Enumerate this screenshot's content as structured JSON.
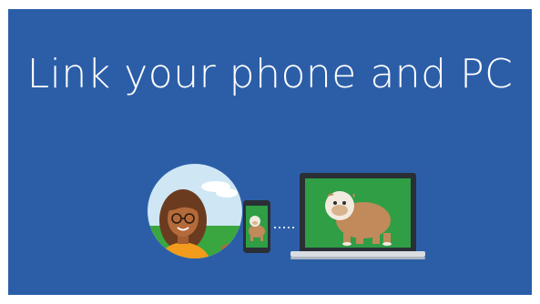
{
  "screen": {
    "title": "Link your phone and PC"
  },
  "illustration": {
    "person_icon": "person-avatar-icon",
    "phone_icon": "smartphone-icon",
    "link_icon": "dotted-link-icon",
    "laptop_icon": "laptop-icon",
    "dog_icon": "bulldog-icon"
  },
  "colors": {
    "background": "#2c5ea8",
    "title_text": "#ffffff",
    "sky": "#cfe6f5",
    "grass": "#3aa640",
    "screen_green": "#2f9e45",
    "device_dark": "#2a2f36",
    "laptop_base": "#d9dde2",
    "skin": "#b56a3a",
    "shirt": "#f29b1d",
    "dog_tan": "#c08a5a"
  }
}
